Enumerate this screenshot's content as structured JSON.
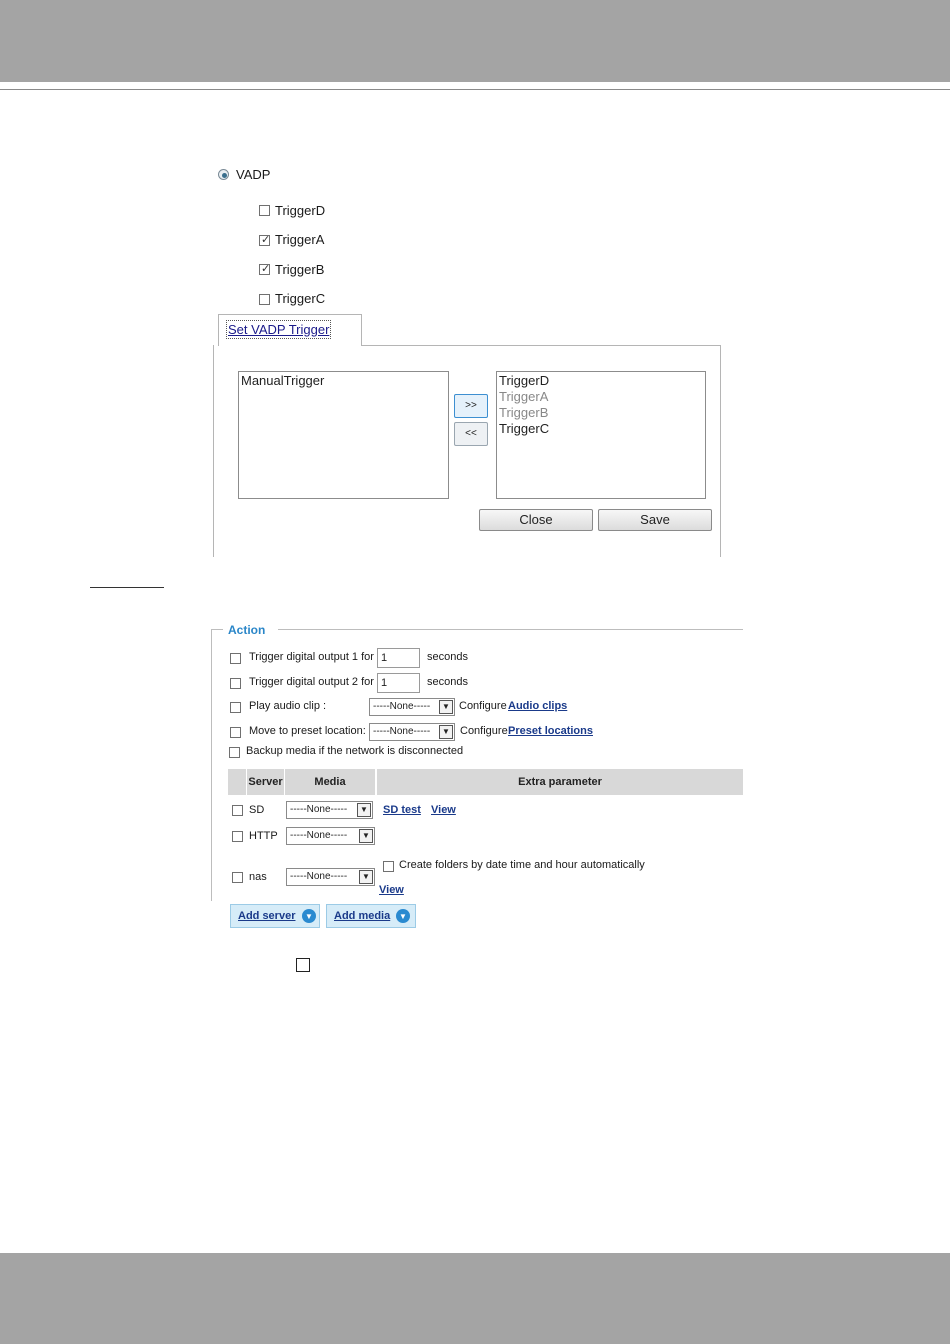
{
  "vadp": {
    "radio_label": "VADP",
    "triggers": [
      {
        "label": "TriggerD",
        "checked": false
      },
      {
        "label": "TriggerA",
        "checked": true
      },
      {
        "label": "TriggerB",
        "checked": true
      },
      {
        "label": "TriggerC",
        "checked": false
      }
    ]
  },
  "trigger_dialog": {
    "tab_label": "Set VADP Trigger",
    "left_list": [
      "ManualTrigger"
    ],
    "right_list": [
      {
        "label": "TriggerD",
        "state": "normal"
      },
      {
        "label": "TriggerA",
        "state": "dimmed"
      },
      {
        "label": "TriggerB",
        "state": "dimmed"
      },
      {
        "label": "TriggerC",
        "state": "normal"
      }
    ],
    "add_arrow_label": ">>",
    "remove_arrow_label": "<<",
    "close_label": "Close",
    "save_label": "Save"
  },
  "action": {
    "legend": "Action",
    "rows": {
      "do1_label": "Trigger digital output 1 for",
      "do1_value": "1",
      "do1_unit": "seconds",
      "do2_label": "Trigger digital output 2 for",
      "do2_value": "1",
      "do2_unit": "seconds",
      "audio_label": "Play audio clip :",
      "audio_select": "-----None-----",
      "audio_config_prefix": "Configure",
      "audio_config_link": "Audio clips",
      "preset_label": "Move to preset location:",
      "preset_select": "-----None-----",
      "preset_config_prefix": "Configure",
      "preset_config_link": "Preset locations",
      "backup_label": "Backup media if the network is disconnected"
    },
    "table": {
      "headers": {
        "server": "Server",
        "media": "Media",
        "extra": "Extra parameter"
      },
      "rows": [
        {
          "server": "SD",
          "media": "-----None-----",
          "links": [
            "SD test",
            "View"
          ]
        },
        {
          "server": "HTTP",
          "media": "-----None-----"
        },
        {
          "server": "nas",
          "media": "-----None-----",
          "extra_checkbox": "Create folders by date time and hour automatically",
          "link": "View"
        }
      ]
    },
    "add_server_label": "Add server",
    "add_media_label": "Add media"
  }
}
